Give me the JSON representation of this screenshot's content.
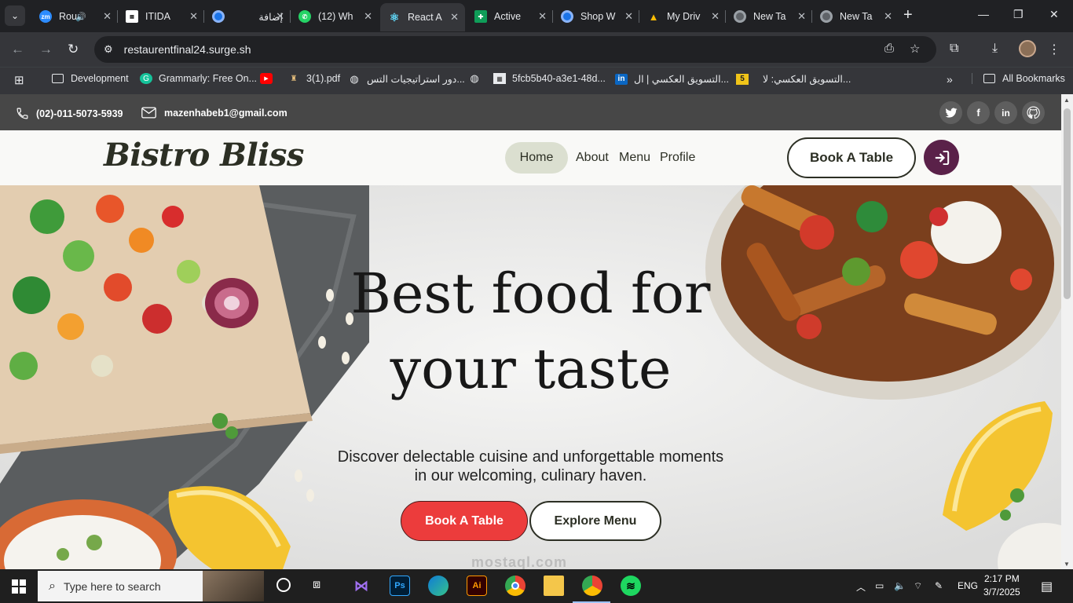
{
  "browser": {
    "tabs": [
      {
        "title": "Rou",
        "icon": "zoom-icon",
        "color": "#2d8cff"
      },
      {
        "title": "ITIDA",
        "icon": "itida-icon",
        "color": "#ffffff"
      },
      {
        "title": "إضافة",
        "icon": "circle-blue-icon",
        "color": "#1a73e8"
      },
      {
        "title": "(12) Wh",
        "icon": "whatsapp-icon",
        "color": "#25d366"
      },
      {
        "title": "React A",
        "icon": "react-icon",
        "color": "#61dafb"
      },
      {
        "title": "Active",
        "icon": "sheets-icon",
        "color": "#0f9d58"
      },
      {
        "title": "Shop W",
        "icon": "circle-blue-icon",
        "color": "#1a73e8"
      },
      {
        "title": "My Driv",
        "icon": "drive-icon",
        "color": "#fbbc04"
      },
      {
        "title": "New Ta",
        "icon": "chrome-icon",
        "color": "#9aa0a6"
      },
      {
        "title": "New Ta",
        "icon": "chrome-icon",
        "color": "#9aa0a6"
      }
    ],
    "url": "restaurentfinal24.surge.sh",
    "bookmarks": [
      {
        "label": "Development",
        "type": "folder"
      },
      {
        "label": "Grammarly: Free On...",
        "icon": "grammarly-icon"
      },
      {
        "label": "",
        "icon": "youtube-icon"
      },
      {
        "label": "3(1).pdf",
        "icon": "pdf-icon"
      },
      {
        "label": "دور استراتيجيات التس...",
        "icon": "globe-icon"
      },
      {
        "label": "5fcb5b40-a3e1-48d...",
        "icon": "globe-icon"
      },
      {
        "label": "التسويق العكسي | ال...",
        "icon": "linkedin-icon"
      },
      {
        "label": "التسويق العكسي: لا...",
        "icon": "five-icon"
      }
    ],
    "all_bookmarks": "All Bookmarks"
  },
  "site": {
    "topbar": {
      "phone": "(02)-011-5073-5939",
      "email": "mazenhabeb1@gmail.com",
      "social": [
        "twitter-icon",
        "facebook-icon",
        "linkedin-icon",
        "github-icon"
      ]
    },
    "header": {
      "logo": "Bistro Bliss",
      "nav": [
        "Home",
        "About",
        "Menu",
        "Profile"
      ],
      "book_button": "Book A Table"
    },
    "hero": {
      "title_line1": "Best food for",
      "title_line2": "your taste",
      "subtitle_line1": "Discover delectable cuisine and unforgettable moments",
      "subtitle_line2": "in our welcoming, culinary haven.",
      "primary_button": "Book A Table",
      "secondary_button": "Explore Menu"
    },
    "watermark": "mostaql.com"
  },
  "taskbar": {
    "search_placeholder": "Type here to search",
    "language": "ENG",
    "time": "2:17 PM",
    "date": "3/7/2025"
  }
}
